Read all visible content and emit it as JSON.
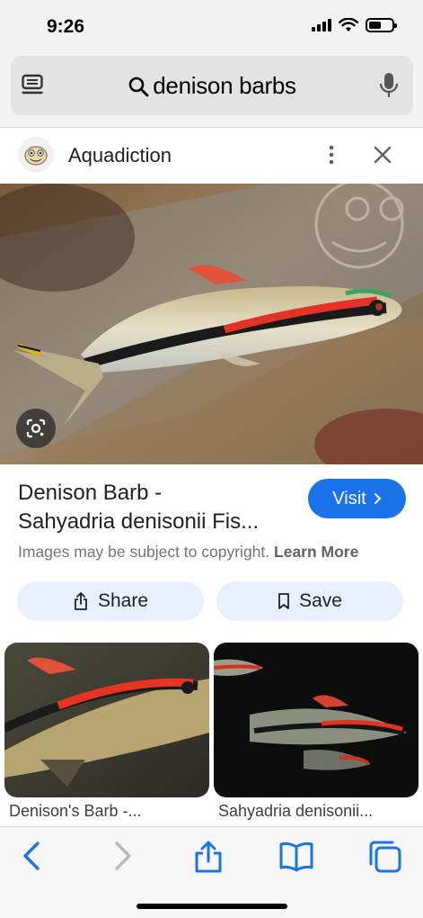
{
  "status_bar": {
    "time": "9:26"
  },
  "search": {
    "query": "denison barbs",
    "icons": [
      "tabs-icon",
      "search-icon",
      "microphone-icon"
    ]
  },
  "source": {
    "name": "Aquadiction",
    "icons": [
      "more-vertical-icon",
      "close-icon"
    ]
  },
  "result": {
    "title_line1": "Denison Barb -",
    "title_line2": "Sahyadria denisonii Fis...",
    "visit_label": "Visit",
    "copyright_text": "Images may be subject to copyright.",
    "learn_more_label": "Learn More"
  },
  "actions": {
    "share_label": "Share",
    "save_label": "Save"
  },
  "related": [
    {
      "caption": "Denison's Barb -..."
    },
    {
      "caption": "Sahyadria denisonii..."
    }
  ],
  "toolbar": {
    "icons": [
      "back-icon",
      "forward-icon",
      "share-icon",
      "bookmarks-icon",
      "tabs-icon"
    ]
  },
  "colors": {
    "accent": "#1a73e8",
    "chip_background": "#e8f0fe",
    "toolbar_icon": "#1a73e8",
    "disabled_icon": "#b8b8bd"
  }
}
